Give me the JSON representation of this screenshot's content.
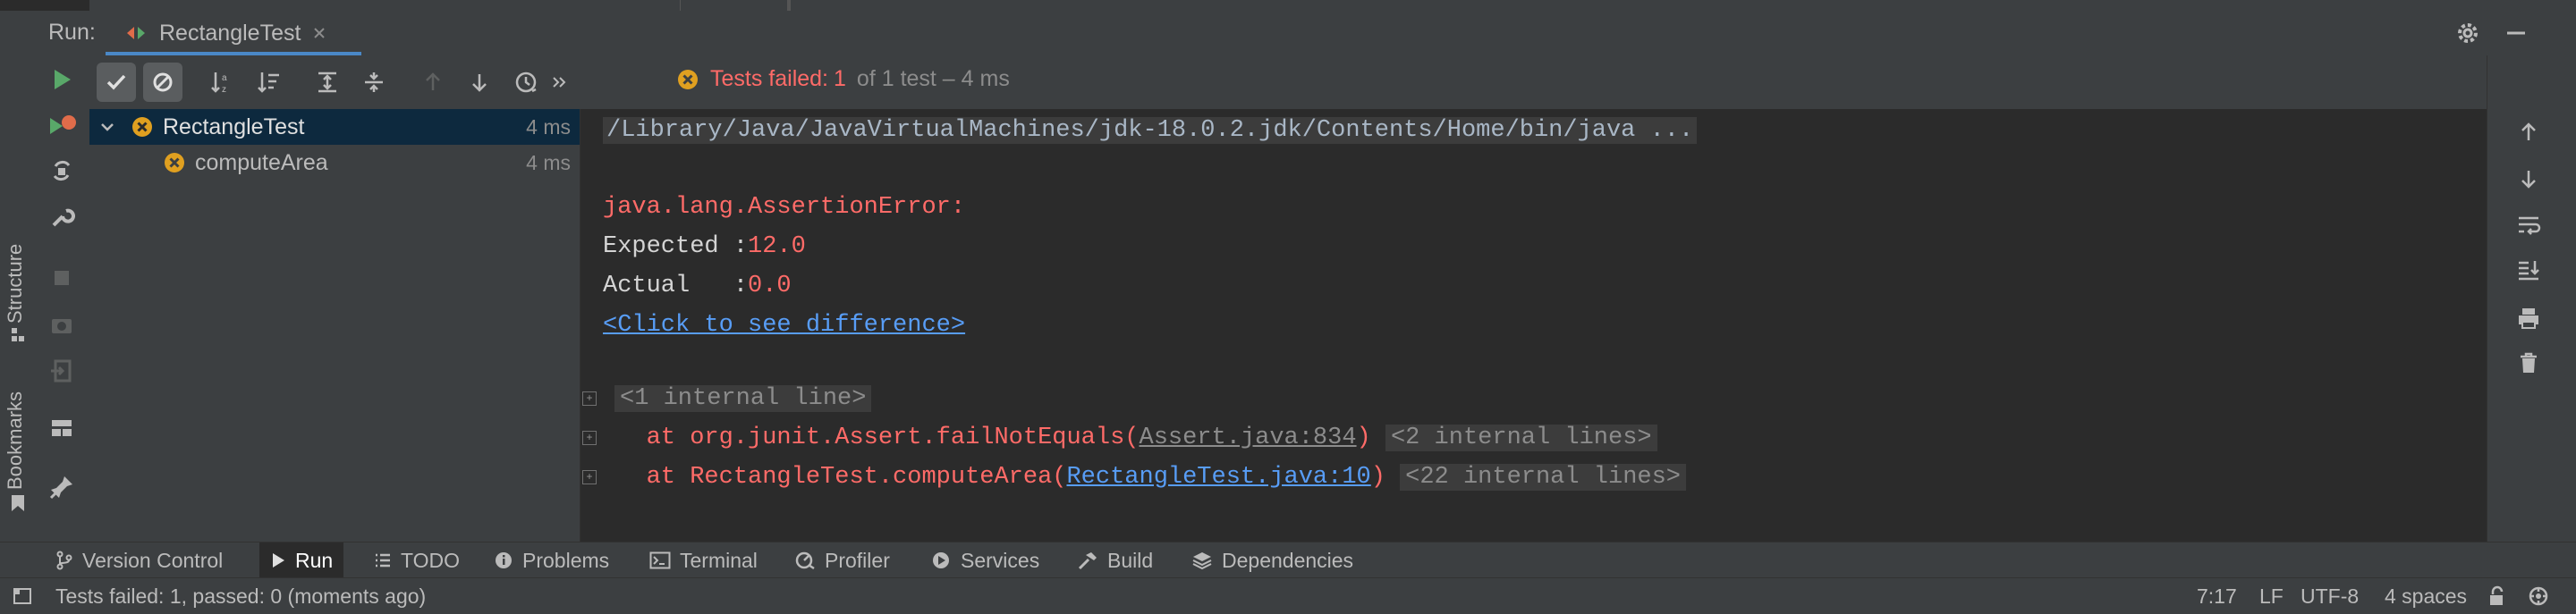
{
  "run_panel": {
    "label": "Run:",
    "tab_name": "RectangleTest"
  },
  "left_stripe": {
    "structure_label": "Structure",
    "bookmarks_label": "Bookmarks"
  },
  "test_status": {
    "failed_label": "Tests failed:",
    "failed_count": "1",
    "summary": "of 1 test – 4 ms"
  },
  "tree": {
    "items": [
      {
        "name": "RectangleTest",
        "time": "4 ms"
      },
      {
        "name": "computeArea",
        "time": "4 ms"
      }
    ]
  },
  "console": {
    "command": "/Library/Java/JavaVirtualMachines/jdk-18.0.2.jdk/Contents/Home/bin/java ...",
    "error": "java.lang.AssertionError:",
    "expected_label": "Expected :",
    "expected_value": "12.0",
    "actual_label": "Actual   :",
    "actual_value": "0.0",
    "diff_link": "<Click to see difference>",
    "internal_line": "<1 internal line>",
    "trace1_prefix": "   at org.junit.Assert.failNotEquals(",
    "trace1_link": "Assert.java:834",
    "trace1_suffix": ")",
    "trace1_fold": "<2 internal lines>",
    "trace2_prefix": "   at RectangleTest.computeArea(",
    "trace2_link": "RectangleTest.java:10",
    "trace2_suffix": ")",
    "trace2_fold": "<22 internal lines>"
  },
  "tool_windows": [
    {
      "label": "Version Control",
      "icon": "branch-icon"
    },
    {
      "label": "Run",
      "icon": "play-icon"
    },
    {
      "label": "TODO",
      "icon": "list-icon"
    },
    {
      "label": "Problems",
      "icon": "info-icon"
    },
    {
      "label": "Terminal",
      "icon": "terminal-icon"
    },
    {
      "label": "Profiler",
      "icon": "gauge-icon"
    },
    {
      "label": "Services",
      "icon": "services-icon"
    },
    {
      "label": "Build",
      "icon": "hammer-icon"
    },
    {
      "label": "Dependencies",
      "icon": "layers-icon"
    }
  ],
  "statusbar": {
    "message": "Tests failed: 1, passed: 0 (moments ago)",
    "position": "7:17",
    "line_ending": "LF",
    "encoding": "UTF-8",
    "indent": "4 spaces"
  },
  "colors": {
    "error": "#ff6b68",
    "link": "#589df6",
    "run_green": "#59a869",
    "fail_orange": "#e0a020"
  }
}
